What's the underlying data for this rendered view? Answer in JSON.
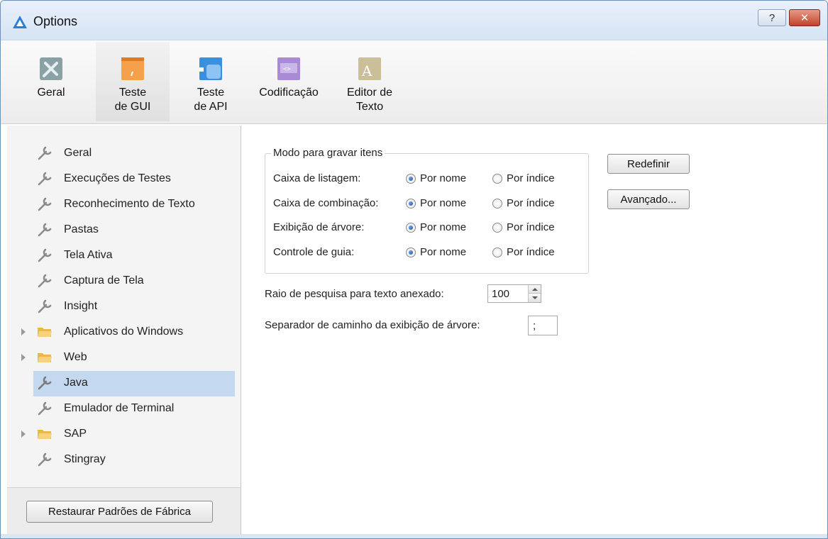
{
  "window": {
    "title": "Options",
    "help_label": "?",
    "close_label": "✕"
  },
  "toolbar": {
    "items": [
      {
        "label": "Geral",
        "icon": "tools-icon"
      },
      {
        "label": "Teste\nde GUI",
        "icon": "gui-test-icon",
        "selected": true
      },
      {
        "label": "Teste\nde API",
        "icon": "api-test-icon"
      },
      {
        "label": "Codificação",
        "icon": "coding-icon"
      },
      {
        "label": "Editor de\nTexto",
        "icon": "text-editor-icon"
      }
    ]
  },
  "tree": {
    "items": [
      {
        "label": "Geral",
        "type": "wrench"
      },
      {
        "label": "Execuções de Testes",
        "type": "wrench"
      },
      {
        "label": "Reconhecimento de Texto",
        "type": "wrench"
      },
      {
        "label": "Pastas",
        "type": "wrench"
      },
      {
        "label": "Tela Ativa",
        "type": "wrench"
      },
      {
        "label": "Captura de Tela",
        "type": "wrench"
      },
      {
        "label": "Insight",
        "type": "wrench"
      },
      {
        "label": "Aplicativos do Windows",
        "type": "folder"
      },
      {
        "label": "Web",
        "type": "folder"
      },
      {
        "label": "Java",
        "type": "wrench",
        "selected": true
      },
      {
        "label": "Emulador de Terminal",
        "type": "wrench"
      },
      {
        "label": "SAP",
        "type": "folder"
      },
      {
        "label": "Stingray",
        "type": "wrench"
      }
    ]
  },
  "restore_button": "Restaurar Padrões de Fábrica",
  "record_mode": {
    "legend": "Modo para gravar itens",
    "by_name": "Por nome",
    "by_index": "Por índice",
    "rows": [
      {
        "label": "Caixa de listagem:",
        "selected": "name"
      },
      {
        "label": "Caixa de combinação:",
        "selected": "name"
      },
      {
        "label": "Exibição de árvore:",
        "selected": "name"
      },
      {
        "label": "Controle de guia:",
        "selected": "name"
      }
    ]
  },
  "buttons": {
    "reset": "Redefinir",
    "advanced": "Avançado..."
  },
  "search_radius": {
    "label": "Raio de pesquisa para texto anexado:",
    "value": "100"
  },
  "tree_separator": {
    "label": "Separador de caminho da exibição de árvore:",
    "value": ";"
  }
}
